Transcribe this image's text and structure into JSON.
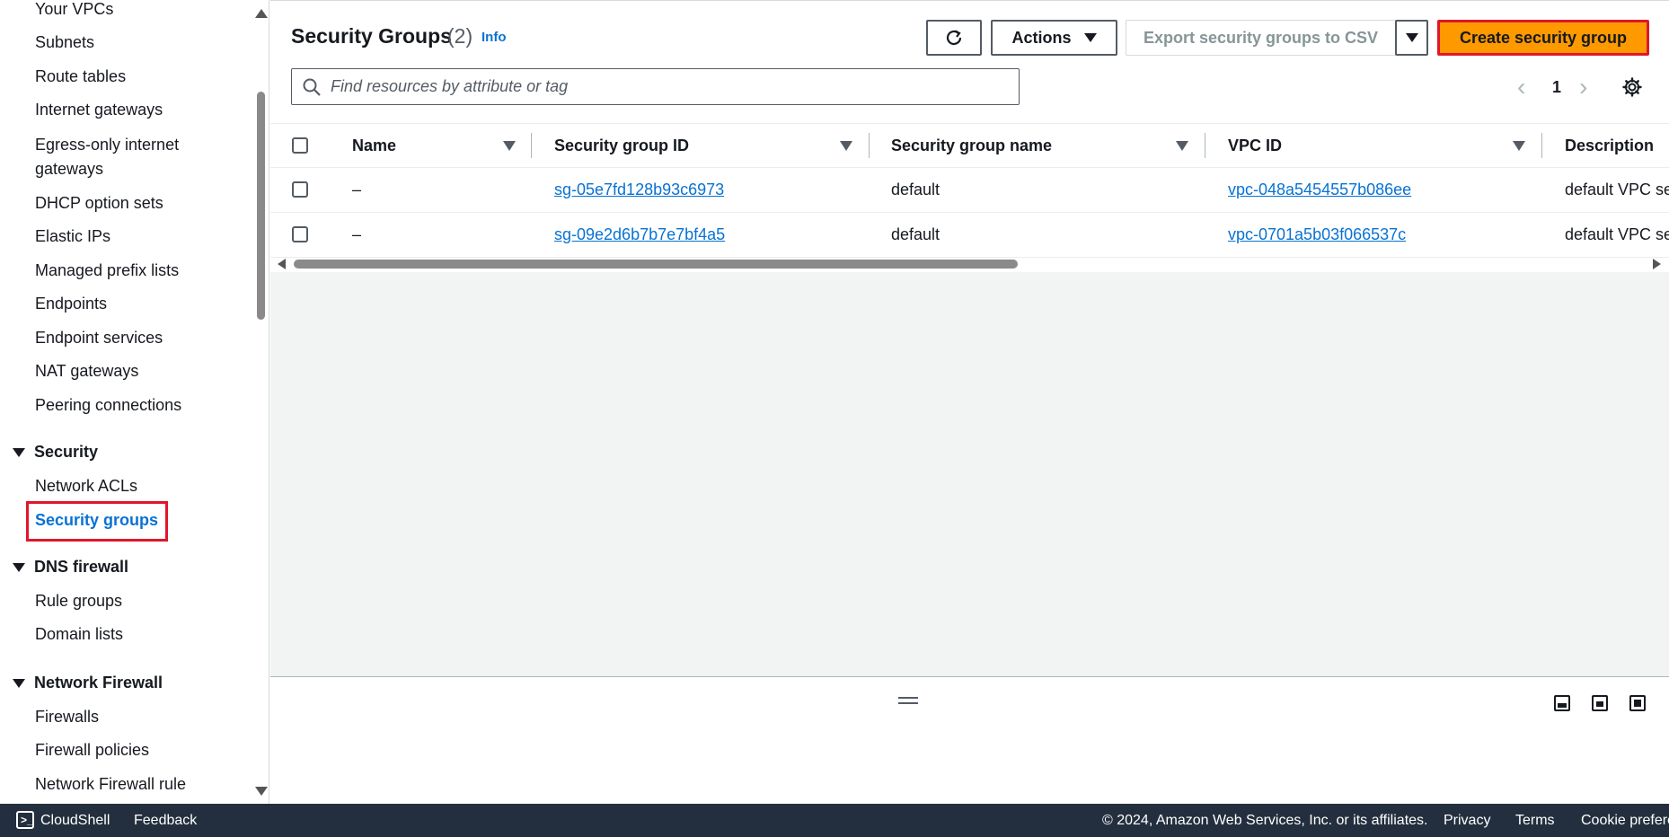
{
  "sidebar": {
    "items_top": [
      "Your VPCs",
      "Subnets",
      "Route tables",
      "Internet gateways",
      "Egress-only internet",
      "gateways",
      "DHCP option sets",
      "Elastic IPs",
      "Managed prefix lists",
      "Endpoints",
      "Endpoint services",
      "NAT gateways",
      "Peering connections"
    ],
    "section_security": "Security",
    "security_items": [
      "Network ACLs",
      "Security groups"
    ],
    "section_dns": "DNS firewall",
    "dns_items": [
      "Rule groups",
      "Domain lists"
    ],
    "section_network_firewall": "Network Firewall",
    "network_firewall_items": [
      "Firewalls",
      "Firewall policies",
      "Network Firewall rule"
    ]
  },
  "header": {
    "title": "Security Groups",
    "count": "(2)",
    "info": "Info",
    "actions_label": "Actions",
    "export_label": "Export security groups to CSV",
    "create_label": "Create security group"
  },
  "search": {
    "placeholder": "Find resources by attribute or tag"
  },
  "pagination": {
    "current_page": "1"
  },
  "table": {
    "columns": [
      "Name",
      "Security group ID",
      "Security group name",
      "VPC ID",
      "Description"
    ],
    "rows": [
      {
        "name": "–",
        "sg_id": "sg-05e7fd128b93c6973",
        "sg_name": "default",
        "vpc_id": "vpc-048a5454557b086ee",
        "description": "default VPC se"
      },
      {
        "name": "–",
        "sg_id": "sg-09e2d6b7b7e7bf4a5",
        "sg_name": "default",
        "vpc_id": "vpc-0701a5b03f066537c",
        "description": "default VPC se"
      }
    ]
  },
  "footer": {
    "cloudshell": "CloudShell",
    "feedback": "Feedback",
    "copyright": "© 2024, Amazon Web Services, Inc. or its affiliates.",
    "privacy": "Privacy",
    "terms": "Terms",
    "cookie": "Cookie prefere"
  },
  "colors": {
    "accent_link": "#0972d3",
    "primary_button": "#ff9900",
    "highlight_border": "#e0162b",
    "footer_bg": "#232f3e"
  }
}
